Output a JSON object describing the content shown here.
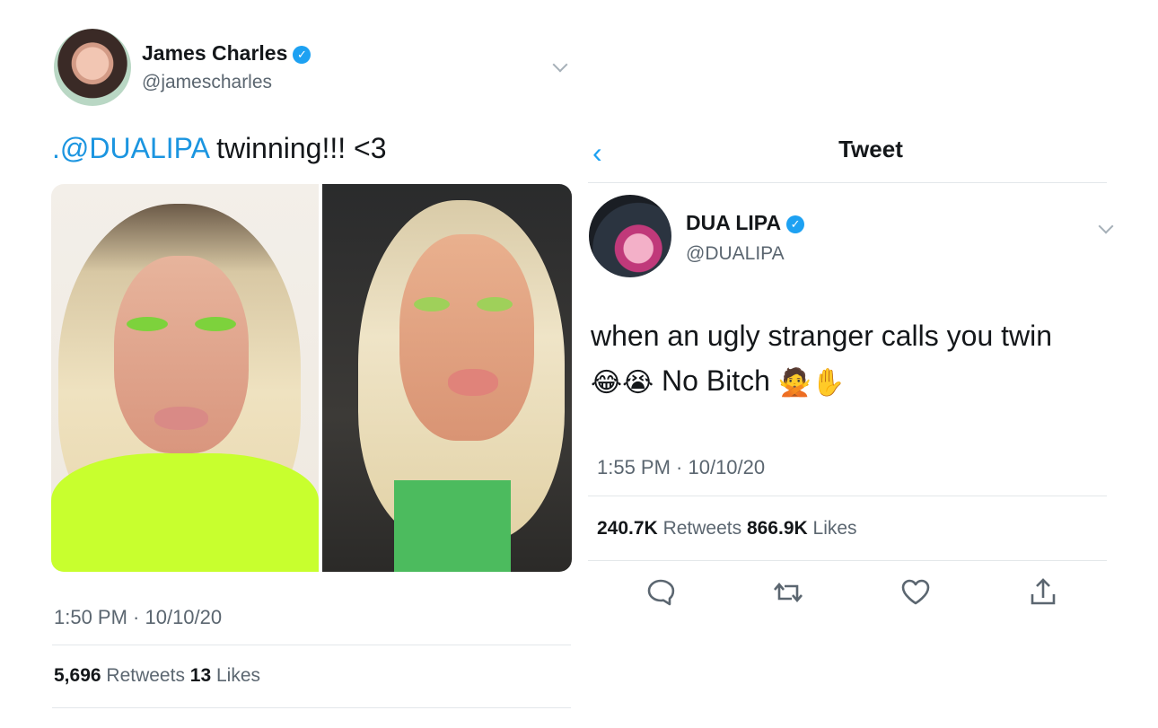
{
  "left_tweet": {
    "author_name": "James Charles",
    "author_handle": "@jamescharles",
    "verified_glyph": "✓",
    "text_mention": ".@DUALIPA",
    "text_body": " twinning!!! <3",
    "timestamp": "1:50 PM · 10/10/20",
    "retweets_count": "5,696",
    "retweets_label": "Retweets",
    "likes_count": "13",
    "likes_label": "Likes"
  },
  "right_tweet": {
    "header_title": "Tweet",
    "back_glyph": "‹",
    "author_name": "DUA LIPA",
    "author_handle": "@DUALIPA",
    "verified_glyph": "✓",
    "text_line1": "when an ugly stranger calls you twin",
    "emoji_laugh": "😂",
    "emoji_cry": "😭",
    "text_line2": "No Bitch",
    "emoji_no": "🙅",
    "emoji_hand": "✋",
    "timestamp": "1:55 PM · 10/10/20",
    "retweets_count": "240.7K",
    "retweets_label": "Retweets",
    "likes_count": "866.9K",
    "likes_label": "Likes"
  },
  "actions": {
    "icons": [
      "reply-icon",
      "retweet-icon",
      "like-icon",
      "share-icon"
    ]
  },
  "colors": {
    "link_blue": "#1b95e0",
    "verified_blue": "#1da1f2",
    "muted_gray": "#5b6670",
    "text_dark": "#14171a",
    "neon_green": "#c8ff2e"
  }
}
